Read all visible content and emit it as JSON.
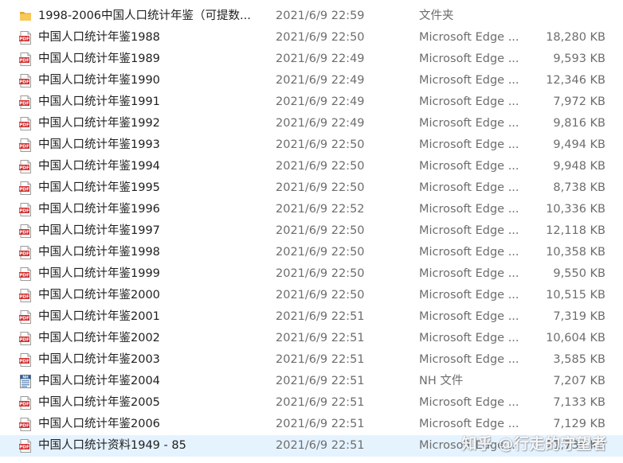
{
  "files": [
    {
      "icon": "folder-icon",
      "name": "1998-2006中国人口统计年鉴（可提数...",
      "date": "2021/6/9 22:59",
      "type": "文件夹",
      "size": ""
    },
    {
      "icon": "pdf-icon",
      "name": "中国人口统计年鉴1988",
      "date": "2021/6/9 22:50",
      "type": "Microsoft Edge ...",
      "size": "18,280 KB"
    },
    {
      "icon": "pdf-icon",
      "name": "中国人口统计年鉴1989",
      "date": "2021/6/9 22:49",
      "type": "Microsoft Edge ...",
      "size": "9,593 KB"
    },
    {
      "icon": "pdf-icon",
      "name": "中国人口统计年鉴1990",
      "date": "2021/6/9 22:49",
      "type": "Microsoft Edge ...",
      "size": "12,346 KB"
    },
    {
      "icon": "pdf-icon",
      "name": "中国人口统计年鉴1991",
      "date": "2021/6/9 22:49",
      "type": "Microsoft Edge ...",
      "size": "7,972 KB"
    },
    {
      "icon": "pdf-icon",
      "name": "中国人口统计年鉴1992",
      "date": "2021/6/9 22:49",
      "type": "Microsoft Edge ...",
      "size": "9,816 KB"
    },
    {
      "icon": "pdf-icon",
      "name": "中国人口统计年鉴1993",
      "date": "2021/6/9 22:50",
      "type": "Microsoft Edge ...",
      "size": "9,494 KB"
    },
    {
      "icon": "pdf-icon",
      "name": "中国人口统计年鉴1994",
      "date": "2021/6/9 22:50",
      "type": "Microsoft Edge ...",
      "size": "9,948 KB"
    },
    {
      "icon": "pdf-icon",
      "name": "中国人口统计年鉴1995",
      "date": "2021/6/9 22:50",
      "type": "Microsoft Edge ...",
      "size": "8,738 KB"
    },
    {
      "icon": "pdf-icon",
      "name": "中国人口统计年鉴1996",
      "date": "2021/6/9 22:52",
      "type": "Microsoft Edge ...",
      "size": "10,336 KB"
    },
    {
      "icon": "pdf-icon",
      "name": "中国人口统计年鉴1997",
      "date": "2021/6/9 22:50",
      "type": "Microsoft Edge ...",
      "size": "12,118 KB"
    },
    {
      "icon": "pdf-icon",
      "name": "中国人口统计年鉴1998",
      "date": "2021/6/9 22:50",
      "type": "Microsoft Edge ...",
      "size": "10,358 KB"
    },
    {
      "icon": "pdf-icon",
      "name": "中国人口统计年鉴1999",
      "date": "2021/6/9 22:50",
      "type": "Microsoft Edge ...",
      "size": "9,550 KB"
    },
    {
      "icon": "pdf-icon",
      "name": "中国人口统计年鉴2000",
      "date": "2021/6/9 22:50",
      "type": "Microsoft Edge ...",
      "size": "10,515 KB"
    },
    {
      "icon": "pdf-icon",
      "name": "中国人口统计年鉴2001",
      "date": "2021/6/9 22:51",
      "type": "Microsoft Edge ...",
      "size": "7,319 KB"
    },
    {
      "icon": "pdf-icon",
      "name": "中国人口统计年鉴2002",
      "date": "2021/6/9 22:51",
      "type": "Microsoft Edge ...",
      "size": "10,604 KB"
    },
    {
      "icon": "pdf-icon",
      "name": "中国人口统计年鉴2003",
      "date": "2021/6/9 22:51",
      "type": "Microsoft Edge ...",
      "size": "3,585 KB"
    },
    {
      "icon": "nh-file-icon",
      "name": "中国人口统计年鉴2004",
      "date": "2021/6/9 22:51",
      "type": "NH 文件",
      "size": "7,207 KB"
    },
    {
      "icon": "pdf-icon",
      "name": "中国人口统计年鉴2005",
      "date": "2021/6/9 22:51",
      "type": "Microsoft Edge ...",
      "size": "7,133 KB"
    },
    {
      "icon": "pdf-icon",
      "name": "中国人口统计年鉴2006",
      "date": "2021/6/9 22:51",
      "type": "Microsoft Edge ...",
      "size": "7,129 KB"
    },
    {
      "icon": "pdf-icon",
      "name": "中国人口统计资料1949 - 85",
      "date": "2021/6/9 22:51",
      "type": "Microsoft Edge ...",
      "size": "21,736 KB",
      "selected": true
    }
  ],
  "watermark": "知乎 @行走的守望者",
  "colors": {
    "selection": "#e5f3ff",
    "pdf_red": "#d32f2f",
    "folder_yellow": "#f5c04a",
    "nh_blue": "#3f6fa8"
  }
}
